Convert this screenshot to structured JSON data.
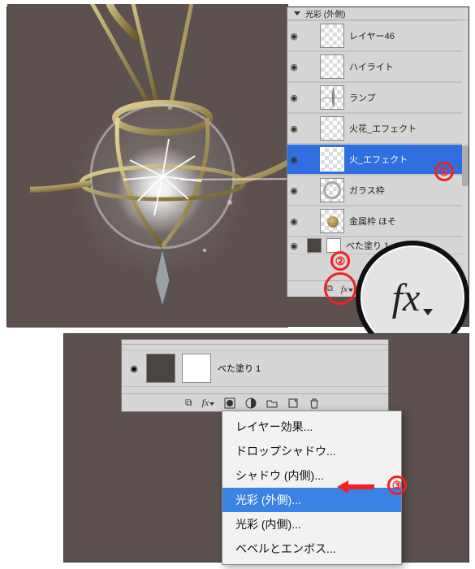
{
  "tutorial_steps": {
    "step1": "①",
    "step2": "②",
    "step3": "③"
  },
  "panel": {
    "header_effect": "光彩 (外側)",
    "fx_label": "fx",
    "layers": [
      {
        "name": "レイヤー46",
        "selected": false,
        "thumb": "checker"
      },
      {
        "name": "ハイライト",
        "selected": false,
        "thumb": "checker"
      },
      {
        "name": "ランプ",
        "selected": false,
        "thumb": "cross"
      },
      {
        "name": "火花_エフェクト",
        "selected": false,
        "thumb": "checker"
      },
      {
        "name": "火_エフェクト",
        "selected": true,
        "thumb": "checker"
      },
      {
        "name": "ガラス枠",
        "selected": false,
        "thumb": "ring"
      },
      {
        "name": "金属枠 ほそ",
        "selected": false,
        "thumb": "golddot"
      },
      {
        "name": "べた塗り 1",
        "selected": false,
        "thumb": "dark"
      }
    ],
    "footer_icons": [
      "link",
      "fx",
      "mask",
      "adjust",
      "group",
      "new",
      "trash"
    ]
  },
  "subpanel": {
    "layer_name": "べた塗り 1"
  },
  "menu": {
    "items": [
      {
        "label": "レイヤー効果...",
        "selected": false
      },
      {
        "label": "ドロップシャドウ...",
        "selected": false
      },
      {
        "label": "シャドウ (内側)...",
        "selected": false
      },
      {
        "label": "光彩 (外側)...",
        "selected": true
      },
      {
        "label": "光彩 (内側)...",
        "selected": false
      },
      {
        "label": "ベベルとエンボス...",
        "selected": false
      }
    ]
  },
  "fx_zoom": "fx"
}
